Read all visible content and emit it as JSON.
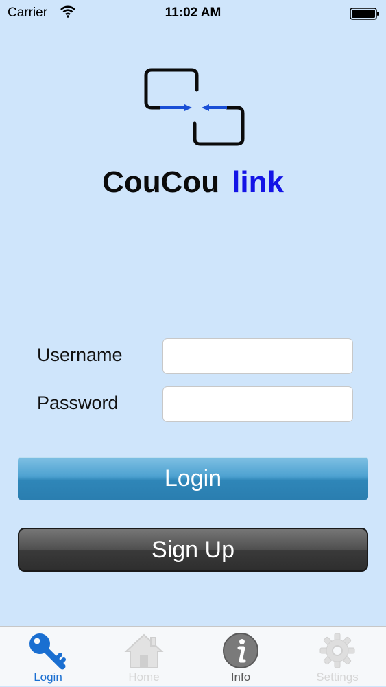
{
  "status_bar": {
    "carrier": "Carrier",
    "time": "11:02 AM"
  },
  "brand": {
    "word1": "CouCou",
    "word2": "link",
    "word2_color": "#1414e6"
  },
  "form": {
    "username_label": "Username",
    "password_label": "Password",
    "username_value": "",
    "password_value": ""
  },
  "buttons": {
    "login": "Login",
    "signup": "Sign Up"
  },
  "tabs": [
    {
      "label": "Login",
      "icon": "key-icon",
      "selected": true
    },
    {
      "label": "Home",
      "icon": "house-icon",
      "selected": false
    },
    {
      "label": "Info",
      "icon": "info-icon",
      "selected": false
    },
    {
      "label": "Settings",
      "icon": "gear-icon",
      "selected": false
    }
  ],
  "colors": {
    "background": "#cfe5fb",
    "login_button": "#3b93c4",
    "signup_button": "#3a3a3a",
    "tab_selected": "#1a6fd1"
  }
}
